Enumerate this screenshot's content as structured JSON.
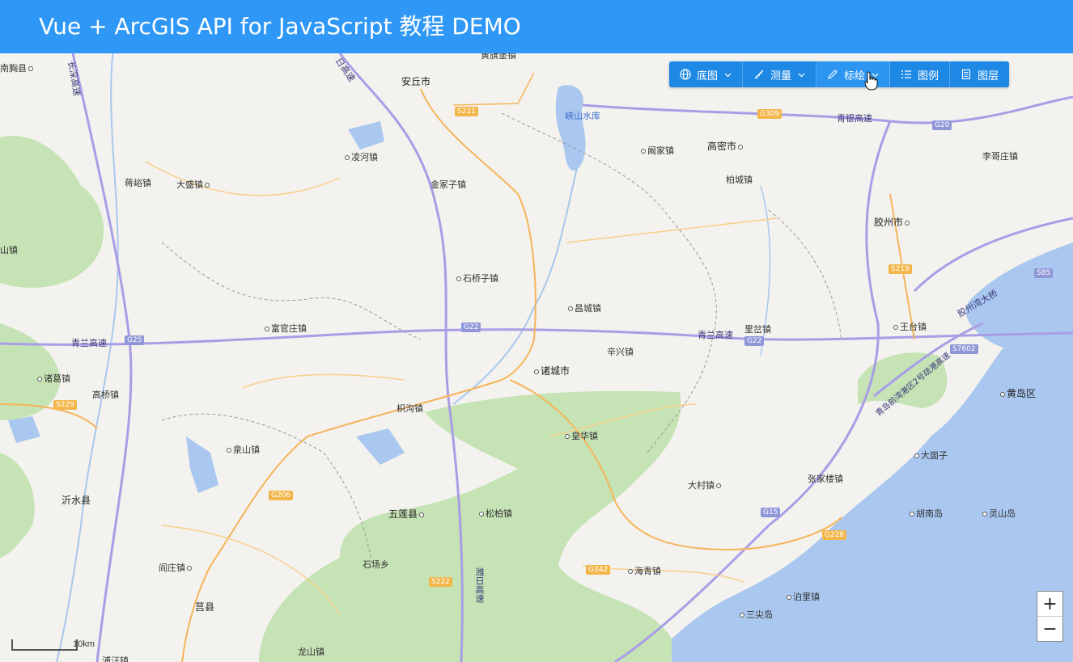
{
  "header": {
    "title": "Vue + ArcGIS API for JavaScript 教程 DEMO"
  },
  "toolbar": {
    "items": [
      {
        "label": "底图",
        "icon": "globe-icon",
        "dropdown": true
      },
      {
        "label": "测量",
        "icon": "ruler-icon",
        "dropdown": true
      },
      {
        "label": "标绘",
        "icon": "pen-icon",
        "dropdown": true
      },
      {
        "label": "图例",
        "icon": "list-icon",
        "dropdown": false
      },
      {
        "label": "图层",
        "icon": "layers-icon",
        "dropdown": false
      }
    ]
  },
  "map": {
    "places": [
      "南胸县",
      "安丘市",
      "黄旗堡镇",
      "凌河镇",
      "蒋峪镇",
      "大盛镇",
      "金冢子镇",
      "峡山水库",
      "阚家镇",
      "高密市",
      "柏城镇",
      "李哥庄镇",
      "胶州市",
      "山镇",
      "石桥子镇",
      "昌城镇",
      "富官庄镇",
      "里岔镇",
      "王台镇",
      "辛兴镇",
      "诸城市",
      "诸葛镇",
      "高桥镇",
      "枳沟镇",
      "皇华镇",
      "黄岛区",
      "大崮子",
      "泉山镇",
      "张家楼镇",
      "大村镇",
      "沂水县",
      "五莲县",
      "松柏镇",
      "胡南岛",
      "灵山岛",
      "阎庄镇",
      "石场乡",
      "海青镇",
      "莒县",
      "泊里镇",
      "三尖岛",
      "龙山镇",
      "浦汪镇"
    ],
    "roads": [
      "长深高速",
      "日高速",
      "青银高速",
      "青兰高速",
      "青兰高速",
      "胶州湾大桥",
      "青岛前湾港区2号疏港高速",
      "潍日高速"
    ],
    "shields": [
      "S221",
      "G309",
      "G20",
      "S219",
      "S85",
      "G22",
      "G22",
      "G25",
      "S7602",
      "G22",
      "S229",
      "G206",
      "G15",
      "G228",
      "G342",
      "S222"
    ],
    "scale_label": "10km",
    "zoom_in": "+",
    "zoom_out": "−"
  }
}
